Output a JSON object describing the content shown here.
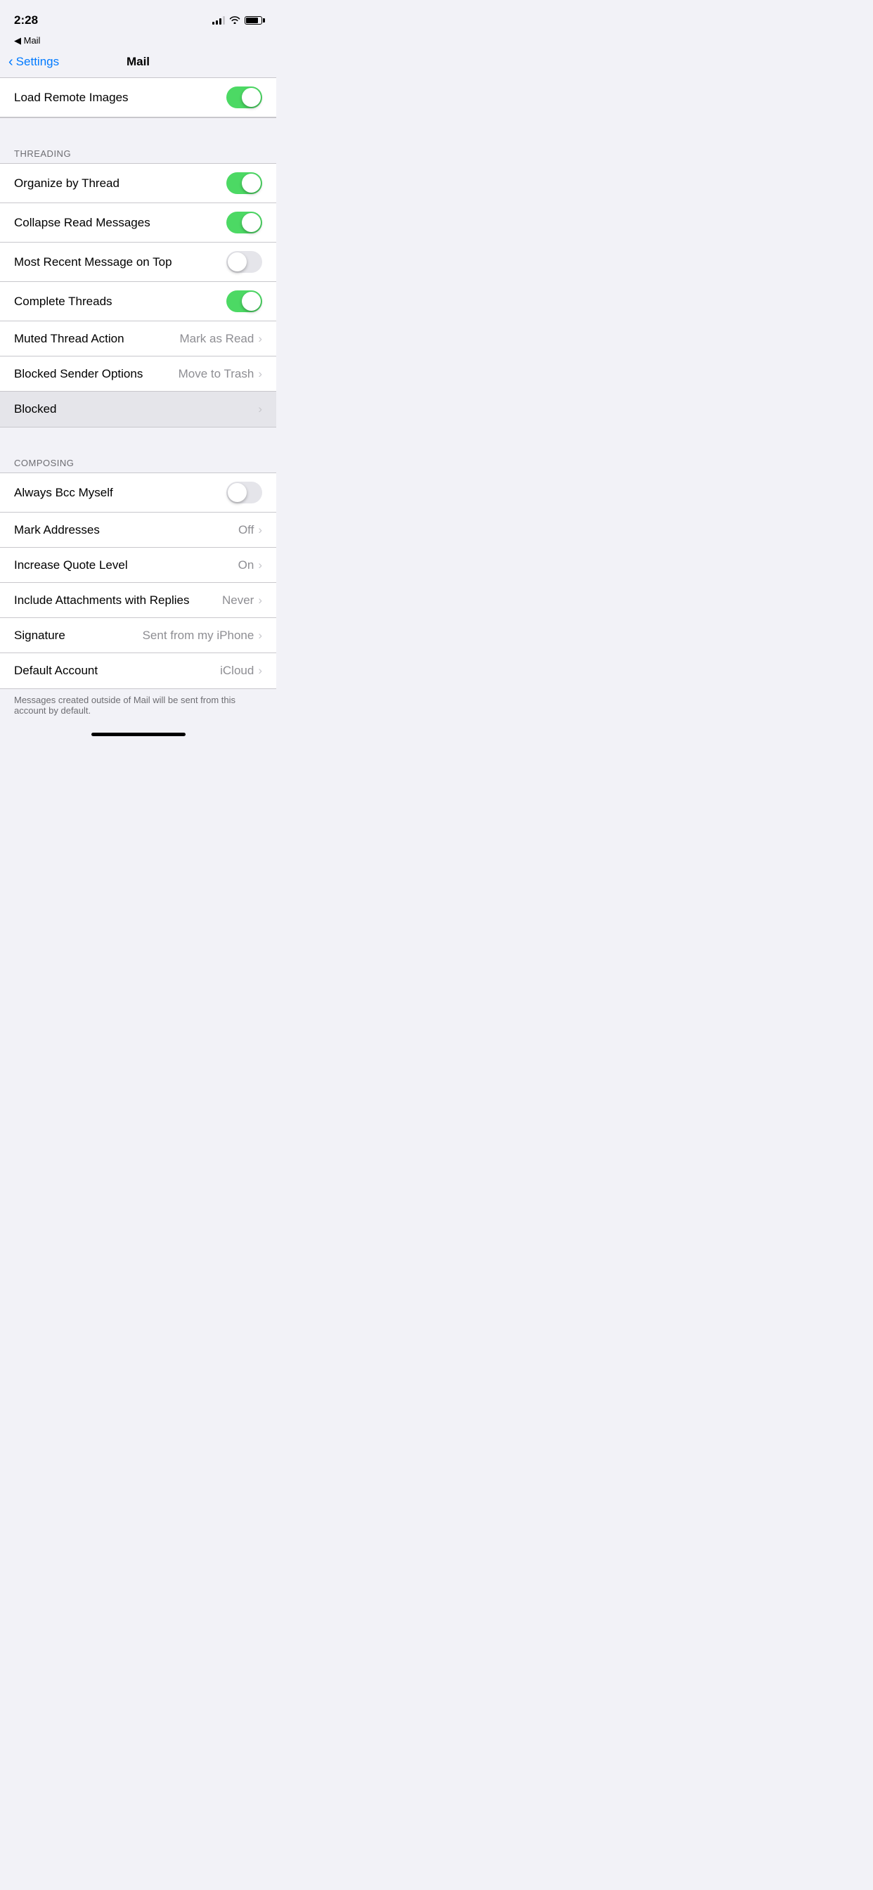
{
  "statusBar": {
    "time": "2:28",
    "backLabel": "◀ Mail"
  },
  "navBar": {
    "backLabel": "Settings",
    "title": "Mail"
  },
  "partialRow": {
    "label": "Load Remote Images",
    "toggleState": "on"
  },
  "threading": {
    "sectionHeader": "THREADING",
    "rows": [
      {
        "label": "Organize by Thread",
        "type": "toggle",
        "toggleState": "on"
      },
      {
        "label": "Collapse Read Messages",
        "type": "toggle",
        "toggleState": "on"
      },
      {
        "label": "Most Recent Message on Top",
        "type": "toggle",
        "toggleState": "off"
      },
      {
        "label": "Complete Threads",
        "type": "toggle",
        "toggleState": "on"
      },
      {
        "label": "Muted Thread Action",
        "type": "value",
        "value": "Mark as Read"
      },
      {
        "label": "Blocked Sender Options",
        "type": "value",
        "value": "Move to Trash"
      },
      {
        "label": "Blocked",
        "type": "nav",
        "value": "",
        "highlighted": true
      }
    ]
  },
  "composing": {
    "sectionHeader": "COMPOSING",
    "rows": [
      {
        "label": "Always Bcc Myself",
        "type": "toggle",
        "toggleState": "off"
      },
      {
        "label": "Mark Addresses",
        "type": "value",
        "value": "Off"
      },
      {
        "label": "Increase Quote Level",
        "type": "value",
        "value": "On"
      },
      {
        "label": "Include Attachments with Replies",
        "type": "value",
        "value": "Never"
      },
      {
        "label": "Signature",
        "type": "value",
        "value": "Sent from my iPhone"
      },
      {
        "label": "Default Account",
        "type": "value",
        "value": "iCloud"
      }
    ]
  },
  "footerNote": "Messages created outside of Mail will be sent from this account by default.",
  "icons": {
    "chevronRight": "›",
    "backChevron": "‹"
  }
}
